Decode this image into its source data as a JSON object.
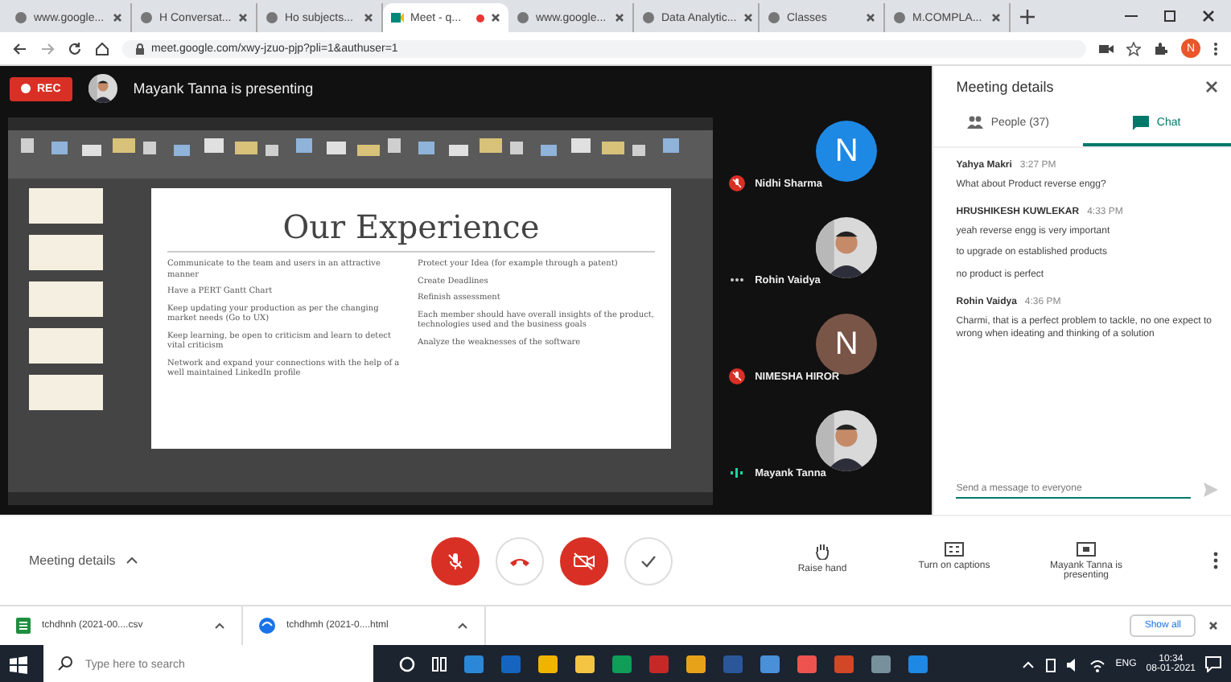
{
  "browser": {
    "tabs": [
      {
        "label": "www.google...",
        "selected": false,
        "recording": false
      },
      {
        "label": "H Conversat...",
        "selected": false,
        "recording": false
      },
      {
        "label": "Ho subjects...",
        "selected": false,
        "recording": false
      },
      {
        "label": "Meet - q...",
        "selected": true,
        "recording": true
      },
      {
        "label": "www.google...",
        "selected": false,
        "recording": false
      },
      {
        "label": "Data Analytic...",
        "selected": false,
        "recording": false
      },
      {
        "label": "Classes",
        "selected": false,
        "recording": false
      },
      {
        "label": "M.COMPLA...",
        "selected": false,
        "recording": false
      }
    ],
    "address": "meet.google.com/xwy-jzuo-pjp?pli=1&authuser=1",
    "profile_initial": "N"
  },
  "meeting": {
    "rec_label": "REC",
    "presenter_banner": "Mayank Tanna is presenting",
    "slide": {
      "title": "Our Experience",
      "left_bullets": [
        "Communicate to the team and users in an attractive manner",
        "Have a PERT Gantt Chart",
        "Keep updating your production as per the changing market needs (Go to UX)",
        "Keep learning, be open to criticism and learn to detect vital criticism",
        "Network and expand your connections with the help of a well maintained LinkedIn profile"
      ],
      "right_bullets": [
        "Protect your Idea (for example through a patent)",
        "Create Deadlines",
        "Refinish assessment",
        "Each member should have overall insights of the product, technologies used and the business goals",
        "Analyze the weaknesses of the software"
      ]
    },
    "participants": [
      {
        "name": "Nidhi Sharma",
        "avatar": {
          "kind": "letter",
          "initial": "N",
          "color": "#1e88e5"
        },
        "status": {
          "kind": "muted"
        }
      },
      {
        "name": "Rohin Vaidya",
        "status": {
          "kind": "more"
        }
      },
      {
        "name": "NIMESHA HIROR",
        "avatar": {
          "kind": "letter",
          "initial": "N",
          "color": "#795548"
        },
        "status": {
          "kind": "muted"
        }
      },
      {
        "name": "Mayank Tanna",
        "status": {
          "kind": "speaking"
        }
      }
    ]
  },
  "panel": {
    "title": "Meeting details",
    "tabs": [
      {
        "label": "People (37)",
        "kind": "people",
        "selected": false
      },
      {
        "label": "Chat",
        "kind": "chat",
        "selected": true
      }
    ],
    "messages": [
      {
        "sender": "Yahya Makri",
        "time": "3:27 PM",
        "lines": [
          "What about Product reverse engg?"
        ]
      },
      {
        "sender": "HRUSHIKESH KUWLEKAR",
        "time": "4:33 PM",
        "lines": [
          "yeah reverse engg is very important",
          "to upgrade on established products",
          "no product is perfect"
        ]
      },
      {
        "sender": "Rohin Vaidya",
        "time": "4:36 PM",
        "lines": [
          "Charmi, that is a perfect problem to tackle, no one expect to wrong when ideating and thinking of a solution"
        ]
      }
    ],
    "input_placeholder": "Send a message to everyone"
  },
  "call_bar": {
    "details_label": "Meeting details",
    "mic_on": false,
    "camera_on": false,
    "actions": [
      {
        "kind": "hand",
        "label": "Raise hand"
      },
      {
        "kind": "captions",
        "label": "Turn on captions"
      },
      {
        "kind": "present",
        "label": "Mayank Tanna is presenting"
      }
    ]
  },
  "downloads": {
    "items": [
      {
        "kind": "sheet",
        "label": "tchdhnh (2021-00....csv"
      },
      {
        "kind": "web",
        "label": "tchdhmh (2021-0....html"
      }
    ],
    "show_all": "Show all"
  },
  "taskbar": {
    "search_placeholder": "Type here to search",
    "language": "ENG",
    "time": "10:34",
    "date": "08-01-2021"
  }
}
